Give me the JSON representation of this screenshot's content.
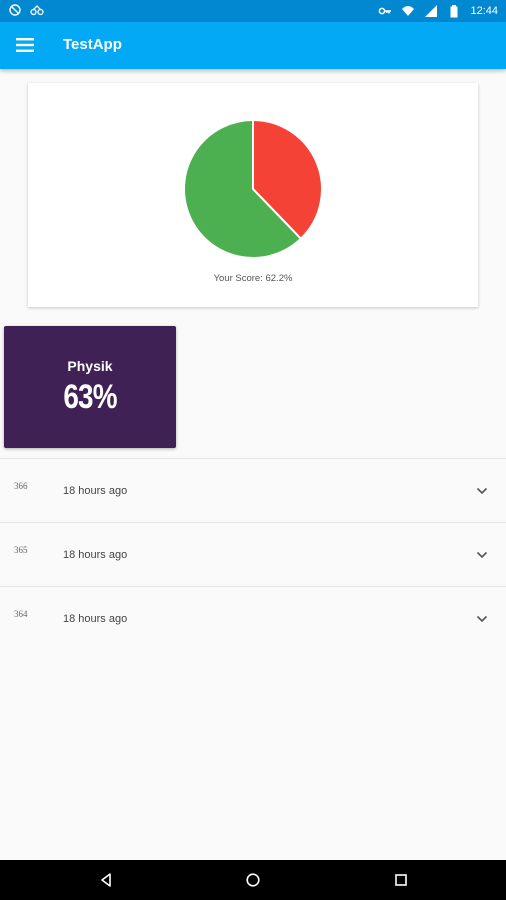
{
  "status_bar": {
    "time": "12:44",
    "left_icons": [
      "blocked-icon",
      "voicemail-icon"
    ],
    "right_icons": [
      "key-icon",
      "wifi-icon",
      "signal-icon",
      "battery-icon"
    ]
  },
  "app_bar": {
    "title": "TestApp",
    "menu_icon": "hamburger-menu-icon"
  },
  "score_card": {
    "caption": "Your Score: 62.2%"
  },
  "chart_data": {
    "type": "pie",
    "values": [
      62.2,
      37.8
    ],
    "colors": [
      "#4caf50",
      "#f44336"
    ],
    "title": "",
    "legend": "none"
  },
  "subject": {
    "name": "Physik",
    "score": "63%",
    "background": "#3f2155"
  },
  "attempts": [
    {
      "id": "366",
      "time": "18 hours ago"
    },
    {
      "id": "365",
      "time": "18 hours ago"
    },
    {
      "id": "364",
      "time": "18 hours ago"
    }
  ],
  "colors": {
    "status_bar": "#0288d1",
    "app_bar": "#03a9f4",
    "background": "#fafafa"
  },
  "nav_bar": {
    "buttons": [
      "back-icon",
      "home-icon",
      "recents-icon"
    ]
  }
}
